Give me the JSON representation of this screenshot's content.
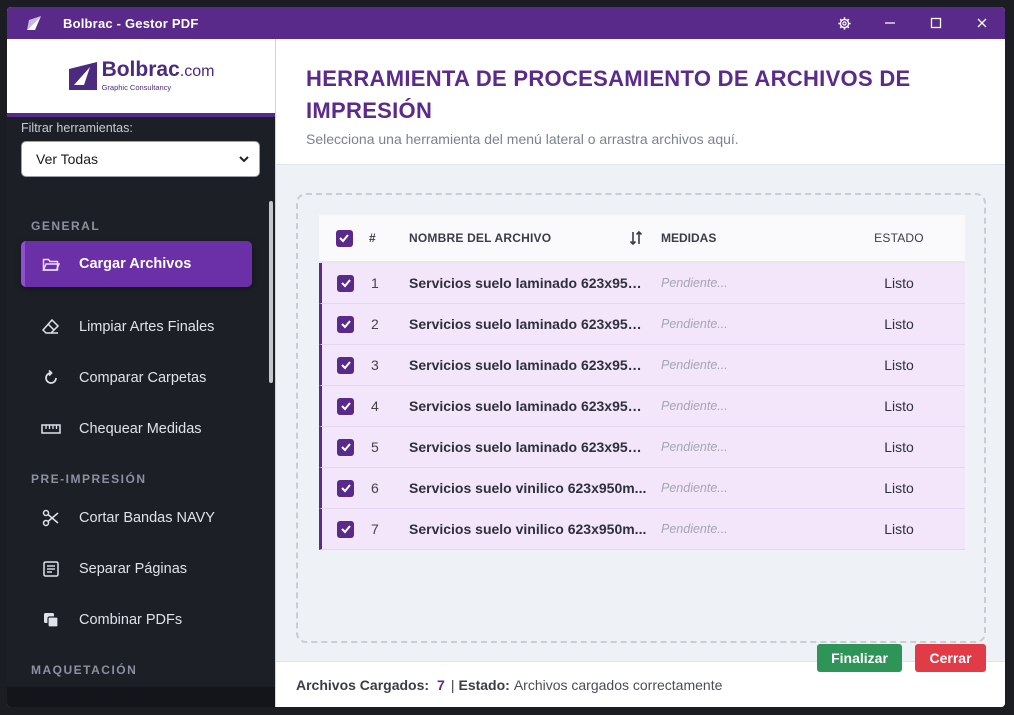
{
  "window": {
    "title": "Bolbrac - Gestor PDF",
    "controls": [
      "settings-icon",
      "minimize-icon",
      "maximize-icon",
      "close-icon"
    ]
  },
  "brand": {
    "name": "Bolbrac",
    "tld": ".com",
    "tagline": "Graphic Consultancy",
    "color": "#4b2a80"
  },
  "sidebar": {
    "filter_label": "Filtrar herramientas:",
    "filter_value": "Ver Todas",
    "sections": [
      {
        "title": "GENERAL",
        "items": [
          {
            "label": "Cargar Archivos",
            "icon": "folder-open-icon",
            "active": true
          },
          {
            "label": "Limpiar Artes Finales",
            "icon": "eraser-icon"
          },
          {
            "label": "Comparar Carpetas",
            "icon": "refresh-icon"
          },
          {
            "label": "Chequear Medidas",
            "icon": "ruler-icon"
          }
        ]
      },
      {
        "title": "PRE-IMPRESIÓN",
        "items": [
          {
            "label": "Cortar Bandas NAVY",
            "icon": "scissors-icon"
          },
          {
            "label": "Separar Páginas",
            "icon": "document-lines-icon"
          },
          {
            "label": "Combinar PDFs",
            "icon": "copy-icon"
          }
        ]
      },
      {
        "title": "MAQUETACIÓN",
        "items": []
      }
    ]
  },
  "header": {
    "title_line1": "HERRAMIENTA DE PROCESAMIENTO DE ARCHIVOS DE",
    "title_line2": "IMPRESIÓN",
    "subtitle": "Selecciona una herramienta del menú lateral o arrastra archivos aquí."
  },
  "table": {
    "columns": {
      "num": "#",
      "name": "NOMBRE DEL ARCHIVO",
      "medidas": "MEDIDAS",
      "estado": "ESTADO"
    },
    "rows": [
      {
        "num": "1",
        "name": "Servicios suelo laminado 623x950...",
        "medidas": "Pendiente...",
        "estado": "Listo"
      },
      {
        "num": "2",
        "name": "Servicios suelo laminado 623x950...",
        "medidas": "Pendiente...",
        "estado": "Listo"
      },
      {
        "num": "3",
        "name": "Servicios suelo laminado 623x950...",
        "medidas": "Pendiente...",
        "estado": "Listo"
      },
      {
        "num": "4",
        "name": "Servicios suelo laminado 623x950...",
        "medidas": "Pendiente...",
        "estado": "Listo"
      },
      {
        "num": "5",
        "name": "Servicios suelo laminado 623x950...",
        "medidas": "Pendiente...",
        "estado": "Listo"
      },
      {
        "num": "6",
        "name": "Servicios suelo vinilico 623x950m...",
        "medidas": "Pendiente...",
        "estado": "Listo"
      },
      {
        "num": "7",
        "name": "Servicios suelo vinilico 623x950m...",
        "medidas": "Pendiente...",
        "estado": "Listo"
      }
    ]
  },
  "status": {
    "files_label": "Archivos Cargados:",
    "files_count": "7",
    "separator": "|",
    "state_label": "Estado:",
    "state_value": "Archivos cargados correctamente"
  },
  "buttons": {
    "finalizar": "Finalizar",
    "cerrar": "Cerrar"
  },
  "colors": {
    "accent": "#5a2a8a",
    "active_item": "#6b2fa8",
    "row_bg": "#f3e6fb",
    "success": "#2f9457",
    "danger": "#e03b47"
  }
}
